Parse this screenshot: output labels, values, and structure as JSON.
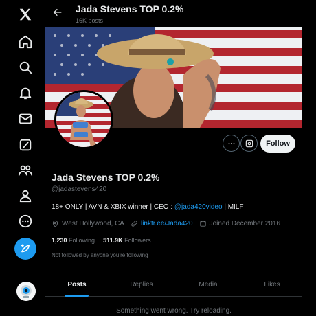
{
  "top_bar": {
    "title": "Jada Stevens TOP 0.2%",
    "post_count": "16K posts"
  },
  "profile": {
    "name": "Jada Stevens TOP 0.2%",
    "handle": "@jadastevens420",
    "bio_prefix": "18+ ONLY | AVN & XBIX winner | CEO : ",
    "bio_mention": "@jada420video",
    "bio_suffix": " | MILF",
    "location": "West Hollywood, CA",
    "website": "linktr.ee/Jada420",
    "joined": "Joined December 2016",
    "following_count": "1,230",
    "following_label": "Following",
    "followers_count": "511.9K",
    "followers_label": "Followers",
    "not_followed": "Not followed by anyone you’re following",
    "follow_button": "Follow"
  },
  "tabs": [
    "Posts",
    "Replies",
    "Media",
    "Likes"
  ],
  "error_message": "Something went wrong. Try reloading.",
  "colors": {
    "accent": "#1d9bf0",
    "background": "#000000",
    "secondary_text": "#71767b"
  },
  "nav_icons": [
    "x-logo-icon",
    "home-icon",
    "explore-icon",
    "notifications-icon",
    "messages-icon",
    "grok-icon",
    "communities-icon",
    "profile-icon",
    "more-icon",
    "compose-icon"
  ]
}
